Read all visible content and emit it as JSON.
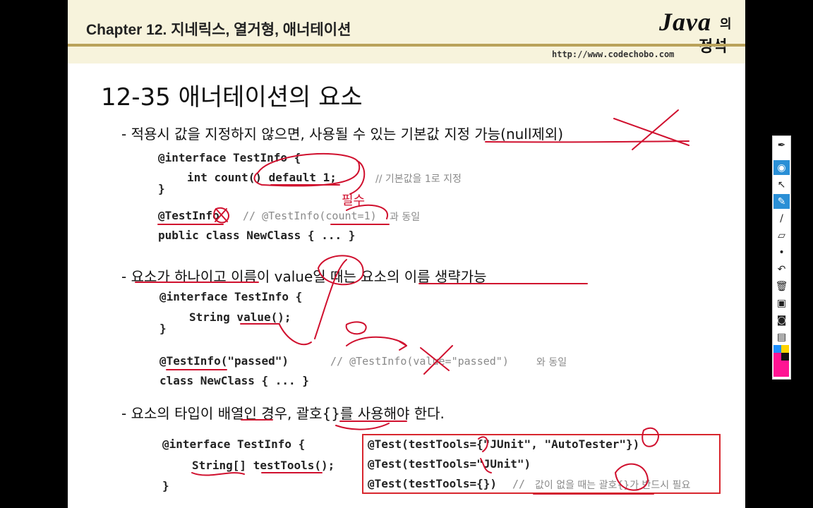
{
  "header": {
    "chapter_title": "Chapter 12. 지네릭스, 열거형, 애너테이션",
    "logo_main": "Java",
    "logo_suffix": "의",
    "logo_sub": "정석",
    "url": "http://www.codechobo.com"
  },
  "slide": {
    "title": "12-35 애너테이션의 요소",
    "bullets": [
      "- 적용시 값을 지정하지 않으면, 사용될 수 있는 기본값 지정 가능(null제외)",
      "- 요소가 하나이고 이름이 value일 때는 요소의 이름 생략가능",
      "- 요소의 타입이 배열인 경우, 괄호{}를 사용해야 한다."
    ],
    "code1": {
      "line1": "@interface TestInfo {",
      "line2": "int count() default 1;",
      "line2_comment": "// 기본값을 1로 지정",
      "line3": "}",
      "line4": "@TestInfo",
      "line4_comment": "// @TestInfo(count=1)",
      "line4_comment_tail": "과 동일",
      "line5": "public class NewClass { ... }"
    },
    "code2": {
      "line1": "@interface TestInfo {",
      "line2": "String value();",
      "line3": "}",
      "line4": "@TestInfo(\"passed\")",
      "line4_comment": "// @TestInfo(value=\"passed\")",
      "line4_comment_tail": "와 동일",
      "line5": "class NewClass { ... }"
    },
    "code3": {
      "line1": "@interface TestInfo {",
      "line2": "String[] testTools();",
      "line3": "}",
      "box_line1": "@Test(testTools={\"JUnit\", \"AutoTester\"})",
      "box_line2": "@Test(testTools=\"JUnit\")",
      "box_line3": "@Test(testTools={})",
      "box_line3_comment": "//",
      "box_line3_comment_k": "값이 없을 때는 괄호{}가 반드시 필요"
    },
    "annotations": {
      "handwritten_note": "필수"
    }
  },
  "toolbar": {
    "tools": [
      "pen-nib-icon",
      "eye-icon",
      "cursor-icon",
      "highlighter-icon",
      "pen-icon",
      "eraser-icon",
      "dot-icon",
      "undo-icon",
      "trash-icon",
      "screen-icon",
      "camera-icon",
      "clipboard-icon"
    ],
    "swatch_colors": [
      "#1e90ff",
      "#ffd400",
      "#ff1493",
      "#111111"
    ],
    "accent": "#2a8fd6"
  },
  "colors": {
    "ink": "#d0102e",
    "box_border": "#d8262e",
    "header_bg": "#f7f3dc",
    "header_bar": "#b9a25a"
  }
}
